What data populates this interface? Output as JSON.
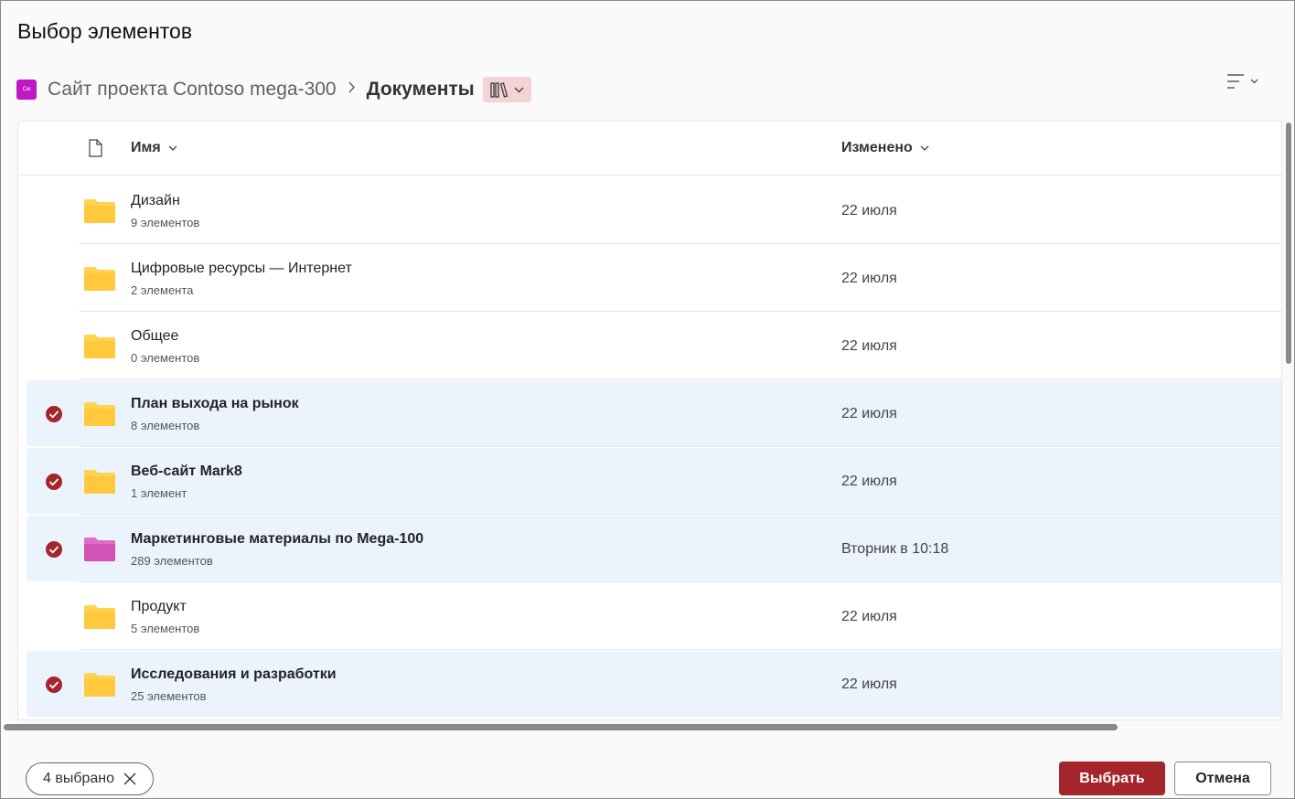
{
  "dialog": {
    "title": "Выбор элементов"
  },
  "breadcrumb": {
    "site_logo_text": "Cм",
    "site": "Сайт проекта Contoso mega-300",
    "library": "Документы"
  },
  "columns": {
    "name": "Имя",
    "modified": "Изменено"
  },
  "colors": {
    "accent": "#a4262c",
    "selected_row": "#ebf3fc",
    "folder_yellow": "#ffc83d",
    "folder_pink": "#d252b5",
    "site_logo": "#c019c4"
  },
  "rows": [
    {
      "name": "Дизайн",
      "count": "9 элементов",
      "modified": "22 июля",
      "selected": false,
      "folder_color": "yellow"
    },
    {
      "name": "Цифровые ресурсы — Интернет",
      "count": "2 элемента",
      "modified": "22 июля",
      "selected": false,
      "folder_color": "yellow"
    },
    {
      "name": "Общее",
      "count": "0 элементов",
      "modified": "22 июля",
      "selected": false,
      "folder_color": "yellow"
    },
    {
      "name": "План выхода на рынок",
      "count": "8 элементов",
      "modified": "22 июля",
      "selected": true,
      "folder_color": "yellow"
    },
    {
      "name": "Веб-сайт Mark8",
      "count": "1 элемент",
      "modified": "22 июля",
      "selected": true,
      "folder_color": "yellow"
    },
    {
      "name": "Маркетинговые материалы по Mega-100",
      "count": "289 элементов",
      "modified": "Вторник в 10:18",
      "selected": true,
      "folder_color": "pink"
    },
    {
      "name": "Продукт",
      "count": "5 элементов",
      "modified": "22 июля",
      "selected": false,
      "folder_color": "yellow"
    },
    {
      "name": "Исследования и разработки",
      "count": "25 элементов",
      "modified": "22 июля",
      "selected": true,
      "folder_color": "yellow"
    }
  ],
  "footer": {
    "selection_chip": "4 выбрано",
    "select_button": "Выбрать",
    "cancel_button": "Отмена"
  }
}
